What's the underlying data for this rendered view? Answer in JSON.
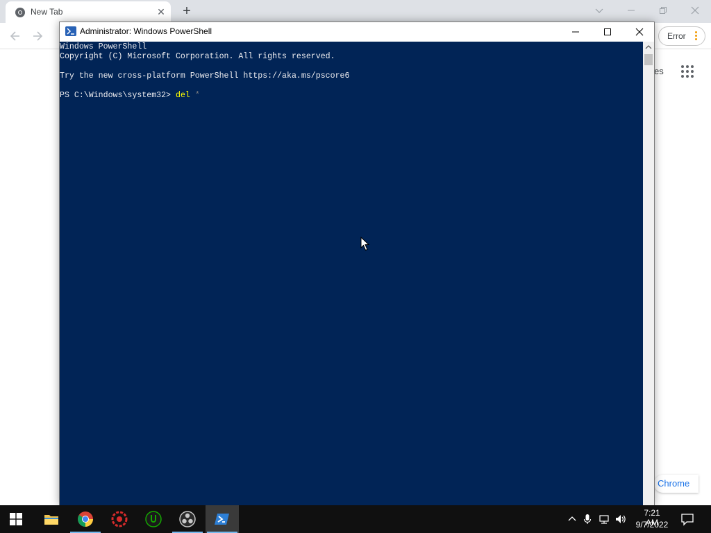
{
  "chrome": {
    "tab_title": "New Tab",
    "tab_close": "✕",
    "new_tab": "+",
    "error_chip_label": "Error",
    "ntp_links_fragment": "es",
    "customize_label": "Chrome"
  },
  "powershell": {
    "title": "Administrator: Windows PowerShell",
    "lines": [
      "Windows PowerShell",
      "Copyright (C) Microsoft Corporation. All rights reserved.",
      "",
      "Try the new cross-platform PowerShell https://aka.ms/pscore6",
      ""
    ],
    "prompt": "PS C:\\Windows\\system32> ",
    "command": "del",
    "argument": " *",
    "colors": {
      "background": "#012456",
      "text": "#eeedf0",
      "command": "#ffff00",
      "argument": "#7f7f7f"
    }
  },
  "taskbar": {
    "apps": [
      {
        "name": "start",
        "icon": "windows-logo-icon"
      },
      {
        "name": "file-explorer",
        "icon": "folder-icon"
      },
      {
        "name": "google-chrome",
        "icon": "chrome-icon"
      },
      {
        "name": "red-app",
        "icon": "red-gear-icon"
      },
      {
        "name": "upwork",
        "icon": "green-u-icon"
      },
      {
        "name": "obs",
        "icon": "obs-icon"
      },
      {
        "name": "powershell",
        "icon": "powershell-icon",
        "active": true
      }
    ],
    "clock_time": "7:21 AM",
    "clock_date": "9/7/2022"
  }
}
